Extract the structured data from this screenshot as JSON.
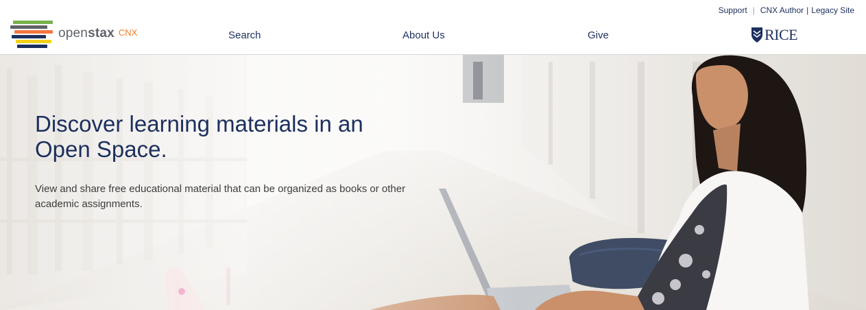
{
  "utility_nav": {
    "support": "Support",
    "separator": "|",
    "cnx_author": "CNX Author",
    "separator2": "|",
    "legacy_site": "Legacy Site"
  },
  "logo": {
    "brand_light": "open",
    "brand_bold": "stax",
    "product": "CNX",
    "stripe_colors": [
      "#78b04a",
      "#5f6368",
      "#f47641",
      "#1c2f5e",
      "#f4d019",
      "#0dc0dc"
    ]
  },
  "main_nav": {
    "search": "Search",
    "about_us": "About Us",
    "give": "Give"
  },
  "partner": {
    "name": "RICE"
  },
  "hero": {
    "headline": "Discover learning materials in an Open Space.",
    "subtext": "View and share free educational material that can be organized as books or other academic assignments."
  },
  "colors": {
    "navy": "#1c2f5e",
    "orange": "#f37c20",
    "text_gray": "#5f6368"
  }
}
